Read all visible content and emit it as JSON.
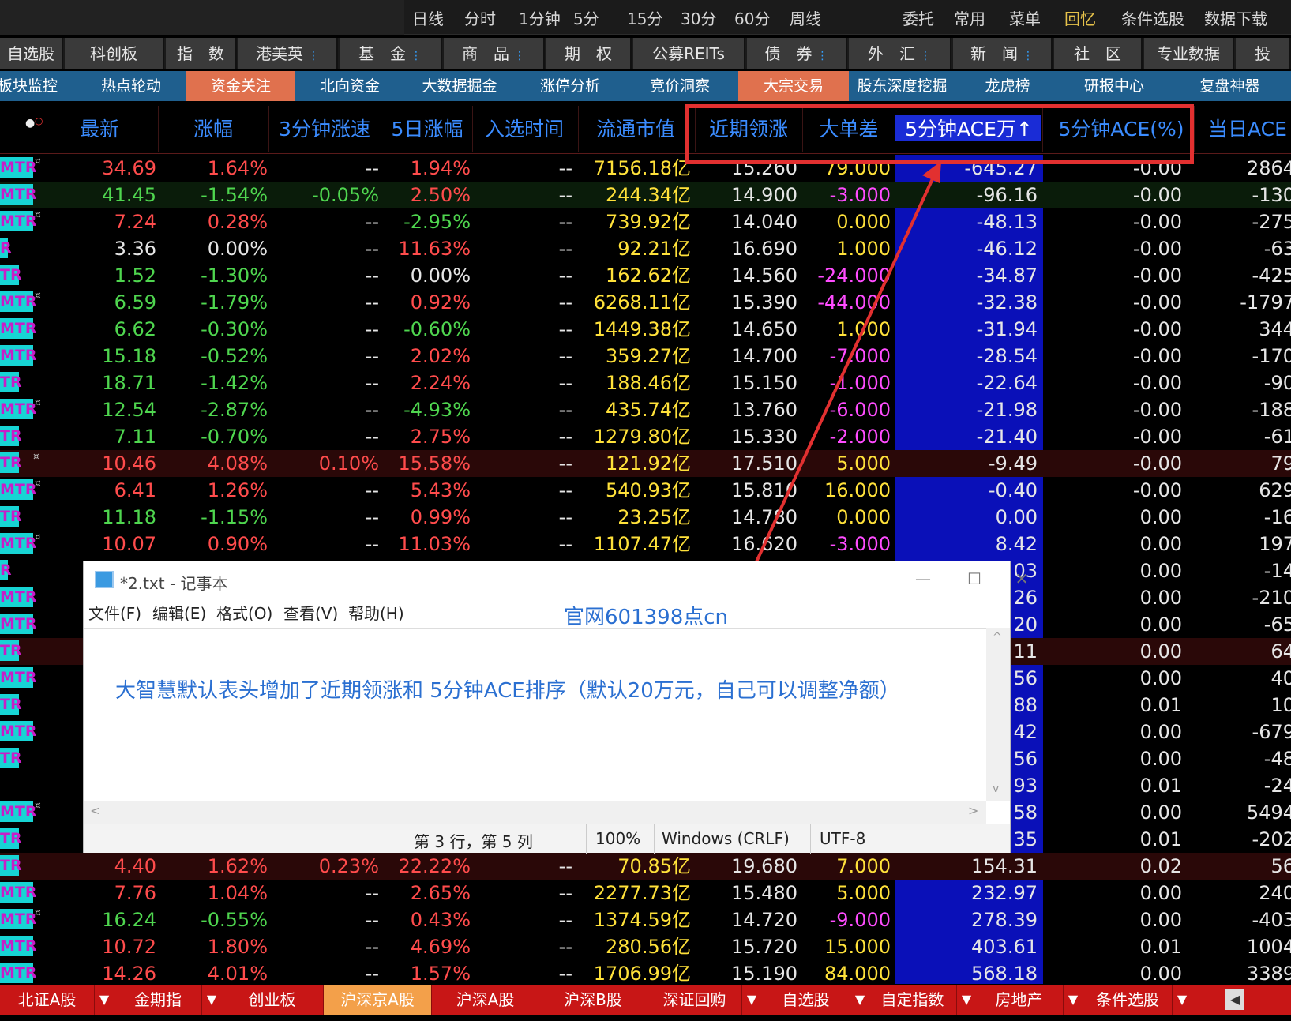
{
  "top_bar": {
    "periods": [
      "日线",
      "分时",
      "1分钟",
      "5分",
      "15分",
      "30分",
      "60分",
      "周线"
    ],
    "right_menu": [
      "委托",
      "常用",
      "菜单",
      "回忆",
      "条件选股",
      "数据下载"
    ]
  },
  "market_tabs": [
    {
      "label": "自选股",
      "dd": false
    },
    {
      "label": "科创板",
      "dd": false
    },
    {
      "label": "指　数",
      "dd": false
    },
    {
      "label": "港美英",
      "dd": true
    },
    {
      "label": "基　金",
      "dd": true
    },
    {
      "label": "商　品",
      "dd": true
    },
    {
      "label": "期　权",
      "dd": false
    },
    {
      "label": "公募REITs",
      "dd": false
    },
    {
      "label": "债　券",
      "dd": true
    },
    {
      "label": "外　汇",
      "dd": true
    },
    {
      "label": "新　闻",
      "dd": true
    },
    {
      "label": "社　区",
      "dd": false
    },
    {
      "label": "专业数据",
      "dd": false
    },
    {
      "label": "投",
      "dd": false
    }
  ],
  "function_bar": [
    {
      "label": "板块监控",
      "active": false
    },
    {
      "label": "热点轮动",
      "active": false
    },
    {
      "label": "资金关注",
      "active": true
    },
    {
      "label": "北向资金",
      "active": false
    },
    {
      "label": "大数据掘金",
      "active": false
    },
    {
      "label": "涨停分析",
      "active": false
    },
    {
      "label": "竞价洞察",
      "active": false
    },
    {
      "label": "大宗交易",
      "active": true
    },
    {
      "label": "股东深度挖掘",
      "active": false
    },
    {
      "label": "龙虎榜",
      "active": false
    },
    {
      "label": "研报中心",
      "active": false
    },
    {
      "label": "复盘神器",
      "active": false
    }
  ],
  "columns": [
    "最新",
    "涨幅",
    "3分钟涨速",
    "5日涨幅",
    "入选时间",
    "流通市值",
    "近期领涨",
    "大单差",
    "5分钟ACE万↑",
    "5分钟ACE(%)",
    "当日ACE"
  ],
  "code_tags": [
    "MTR",
    "TR"
  ],
  "rows": [
    {
      "tag": "MTR",
      "star": true,
      "last": "34.69",
      "chg": "1.64%",
      "spd": "--",
      "d5": "1.94%",
      "sel": "--",
      "cap": "7156.18亿",
      "lead": "15.260",
      "big": "79.000",
      "ace": "-645.27",
      "acep": "-0.00",
      "day": "2864"
    },
    {
      "tag": "MTR",
      "star": false,
      "last": "41.45",
      "chg": "-1.54%",
      "spd": "-0.05%",
      "d5": "2.50%",
      "sel": "--",
      "cap": "244.34亿",
      "lead": "14.900",
      "big": "-3.000",
      "ace": "-96.16",
      "acep": "-0.00",
      "day": "-130"
    },
    {
      "tag": "MTR",
      "star": true,
      "last": "7.24",
      "chg": "0.28%",
      "spd": "--",
      "d5": "-2.95%",
      "sel": "--",
      "cap": "739.92亿",
      "lead": "14.040",
      "big": "0.000",
      "ace": "-48.13",
      "acep": "-0.00",
      "day": "-275"
    },
    {
      "tag": "R",
      "star": false,
      "last": "3.36",
      "chg": "0.00%",
      "spd": "--",
      "d5": "11.63%",
      "sel": "--",
      "cap": "92.21亿",
      "lead": "16.690",
      "big": "1.000",
      "ace": "-46.12",
      "acep": "-0.00",
      "day": "-63"
    },
    {
      "tag": "TR",
      "star": false,
      "last": "1.52",
      "chg": "-1.30%",
      "spd": "--",
      "d5": "0.00%",
      "sel": "--",
      "cap": "162.62亿",
      "lead": "14.560",
      "big": "-24.000",
      "ace": "-34.87",
      "acep": "-0.00",
      "day": "-425"
    },
    {
      "tag": "MTR",
      "star": true,
      "last": "6.59",
      "chg": "-1.79%",
      "spd": "--",
      "d5": "0.92%",
      "sel": "--",
      "cap": "6268.11亿",
      "lead": "15.390",
      "big": "-44.000",
      "ace": "-32.38",
      "acep": "-0.00",
      "day": "-1797"
    },
    {
      "tag": "MTR",
      "star": false,
      "last": "6.62",
      "chg": "-0.30%",
      "spd": "--",
      "d5": "-0.60%",
      "sel": "--",
      "cap": "1449.38亿",
      "lead": "14.650",
      "big": "1.000",
      "ace": "-31.94",
      "acep": "-0.00",
      "day": "344"
    },
    {
      "tag": "MTR",
      "star": false,
      "last": "15.18",
      "chg": "-0.52%",
      "spd": "--",
      "d5": "2.02%",
      "sel": "--",
      "cap": "359.27亿",
      "lead": "14.700",
      "big": "-7.000",
      "ace": "-28.54",
      "acep": "-0.00",
      "day": "-170"
    },
    {
      "tag": "TR",
      "star": false,
      "last": "18.71",
      "chg": "-1.42%",
      "spd": "--",
      "d5": "2.24%",
      "sel": "--",
      "cap": "188.46亿",
      "lead": "15.150",
      "big": "-1.000",
      "ace": "-22.64",
      "acep": "-0.00",
      "day": "-90"
    },
    {
      "tag": "MTR",
      "star": true,
      "last": "12.54",
      "chg": "-2.87%",
      "spd": "--",
      "d5": "-4.93%",
      "sel": "--",
      "cap": "435.74亿",
      "lead": "13.760",
      "big": "-6.000",
      "ace": "-21.98",
      "acep": "-0.00",
      "day": "-188"
    },
    {
      "tag": "TR",
      "star": false,
      "last": "7.11",
      "chg": "-0.70%",
      "spd": "--",
      "d5": "2.75%",
      "sel": "--",
      "cap": "1279.80亿",
      "lead": "15.330",
      "big": "-2.000",
      "ace": "-21.40",
      "acep": "-0.00",
      "day": "-61"
    },
    {
      "tag": "TR",
      "star": true,
      "last": "10.46",
      "chg": "4.08%",
      "spd": "0.10%",
      "d5": "15.58%",
      "sel": "--",
      "cap": "121.92亿",
      "lead": "17.510",
      "big": "5.000",
      "ace": "-9.49",
      "acep": "-0.00",
      "day": "79"
    },
    {
      "tag": "MTR",
      "star": true,
      "last": "6.41",
      "chg": "1.26%",
      "spd": "--",
      "d5": "5.43%",
      "sel": "--",
      "cap": "540.93亿",
      "lead": "15.810",
      "big": "16.000",
      "ace": "-0.40",
      "acep": "-0.00",
      "day": "629"
    },
    {
      "tag": "TR",
      "star": false,
      "last": "11.18",
      "chg": "-1.15%",
      "spd": "--",
      "d5": "0.99%",
      "sel": "--",
      "cap": "23.25亿",
      "lead": "14.780",
      "big": "0.000",
      "ace": "0.00",
      "acep": "0.00",
      "day": "-16"
    },
    {
      "tag": "MTR",
      "star": true,
      "last": "10.07",
      "chg": "0.90%",
      "spd": "--",
      "d5": "11.03%",
      "sel": "--",
      "cap": "1107.47亿",
      "lead": "16.620",
      "big": "-3.000",
      "ace": "8.42",
      "acep": "0.00",
      "day": "197"
    },
    {
      "tag": "R",
      "star": false,
      "last": "",
      "chg": "",
      "spd": "",
      "d5": "",
      "sel": "",
      "cap": "",
      "lead": "",
      "big": "",
      "ace": ".03",
      "acep": "0.00",
      "day": "-14"
    },
    {
      "tag": "MTR",
      "star": false,
      "last": "",
      "chg": "",
      "spd": "",
      "d5": "",
      "sel": "",
      "cap": "",
      "lead": "",
      "big": "",
      "ace": ".26",
      "acep": "0.00",
      "day": "-210"
    },
    {
      "tag": "MTR",
      "star": false,
      "last": "",
      "chg": "",
      "spd": "",
      "d5": "",
      "sel": "",
      "cap": "",
      "lead": "",
      "big": "",
      "ace": ".20",
      "acep": "0.00",
      "day": "-65"
    },
    {
      "tag": "TR",
      "star": false,
      "last": "",
      "chg": "",
      "spd": "",
      "d5": "",
      "sel": "",
      "cap": "",
      "lead": "",
      "big": "",
      "ace": ".11",
      "acep": "0.00",
      "day": "64"
    },
    {
      "tag": "MTR",
      "star": false,
      "last": "",
      "chg": "",
      "spd": "",
      "d5": "",
      "sel": "",
      "cap": "",
      "lead": "",
      "big": "",
      "ace": ".56",
      "acep": "0.00",
      "day": "40"
    },
    {
      "tag": "TR",
      "star": false,
      "last": "",
      "chg": "",
      "spd": "",
      "d5": "",
      "sel": "",
      "cap": "",
      "lead": "",
      "big": "",
      "ace": ".88",
      "acep": "0.01",
      "day": "10"
    },
    {
      "tag": "MTR",
      "star": false,
      "last": "",
      "chg": "",
      "spd": "",
      "d5": "",
      "sel": "",
      "cap": "",
      "lead": "",
      "big": "",
      "ace": ".42",
      "acep": "0.00",
      "day": "-679"
    },
    {
      "tag": "TR",
      "star": false,
      "last": "",
      "chg": "",
      "spd": "",
      "d5": "",
      "sel": "",
      "cap": "",
      "lead": "",
      "big": "",
      "ace": ".56",
      "acep": "0.00",
      "day": "-48"
    },
    {
      "tag": "",
      "star": false,
      "last": "",
      "chg": "",
      "spd": "",
      "d5": "",
      "sel": "",
      "cap": "",
      "lead": "",
      "big": "",
      "ace": ".93",
      "acep": "0.01",
      "day": "-24"
    },
    {
      "tag": "MTR",
      "star": true,
      "last": "",
      "chg": "",
      "spd": "",
      "d5": "",
      "sel": "",
      "cap": "",
      "lead": "",
      "big": "",
      "ace": ".58",
      "acep": "0.00",
      "day": "5494"
    },
    {
      "tag": "TR",
      "star": false,
      "last": "",
      "chg": "",
      "spd": "",
      "d5": "",
      "sel": "",
      "cap": "",
      "lead": "",
      "big": "",
      "ace": ".35",
      "acep": "0.01",
      "day": "-202"
    },
    {
      "tag": "TR",
      "star": false,
      "last": "4.40",
      "chg": "1.62%",
      "spd": "0.23%",
      "d5": "22.22%",
      "sel": "--",
      "cap": "70.85亿",
      "lead": "19.680",
      "big": "7.000",
      "ace": "154.31",
      "acep": "0.02",
      "day": "56"
    },
    {
      "tag": "MTR",
      "star": false,
      "last": "7.76",
      "chg": "1.04%",
      "spd": "--",
      "d5": "2.65%",
      "sel": "--",
      "cap": "2277.73亿",
      "lead": "15.480",
      "big": "5.000",
      "ace": "232.97",
      "acep": "0.00",
      "day": "240"
    },
    {
      "tag": "MTR",
      "star": true,
      "last": "16.24",
      "chg": "-0.55%",
      "spd": "--",
      "d5": "0.43%",
      "sel": "--",
      "cap": "1374.59亿",
      "lead": "14.720",
      "big": "-9.000",
      "ace": "278.39",
      "acep": "0.00",
      "day": "-403"
    },
    {
      "tag": "MTR",
      "star": false,
      "last": "10.72",
      "chg": "1.80%",
      "spd": "--",
      "d5": "4.69%",
      "sel": "--",
      "cap": "280.56亿",
      "lead": "15.720",
      "big": "15.000",
      "ace": "403.61",
      "acep": "0.01",
      "day": "1004"
    },
    {
      "tag": "MTR",
      "star": false,
      "last": "14.26",
      "chg": "4.01%",
      "spd": "--",
      "d5": "1.57%",
      "sel": "--",
      "cap": "1706.99亿",
      "lead": "15.190",
      "big": "84.000",
      "ace": "568.18",
      "acep": "0.00",
      "day": "3389"
    }
  ],
  "notepad": {
    "title": "*2.txt - 记事本",
    "menu": [
      "文件(F)",
      "编辑(E)",
      "格式(O)",
      "查看(V)",
      "帮助(H)"
    ],
    "watermark": "官网601398点cn",
    "text": "大智慧默认表头增加了近期领涨和 5分钟ACE排序（默认20万元，自己可以调整净额）",
    "status": {
      "pos": "第 3 行，第 5 列",
      "zoom": "100%",
      "eol": "Windows (CRLF)",
      "enc": "UTF-8"
    }
  },
  "bottom_tabs": [
    {
      "label": "北证A股",
      "dd": true,
      "active": false
    },
    {
      "label": "金期指",
      "dd": true,
      "active": false
    },
    {
      "label": "创业板",
      "dd": false,
      "active": false
    },
    {
      "label": "沪深京A股",
      "dd": false,
      "active": true
    },
    {
      "label": "沪深A股",
      "dd": false,
      "active": false
    },
    {
      "label": "沪深B股",
      "dd": false,
      "active": false
    },
    {
      "label": "深证回购",
      "dd": true,
      "active": false
    },
    {
      "label": "自选股",
      "dd": true,
      "active": false
    },
    {
      "label": "自定指数",
      "dd": true,
      "active": false
    },
    {
      "label": "房地产",
      "dd": true,
      "active": false
    },
    {
      "label": "条件选股",
      "dd": true,
      "active": false
    }
  ],
  "colors": {
    "red": "#ff4c4c",
    "green": "#4fd64f",
    "white": "#e6e6e6",
    "yellow": "#ffe13a",
    "magenta": "#ff4cff",
    "header": "#3b8cff",
    "sort_col": "#0a10b8",
    "highlight_box": "#e23030"
  }
}
